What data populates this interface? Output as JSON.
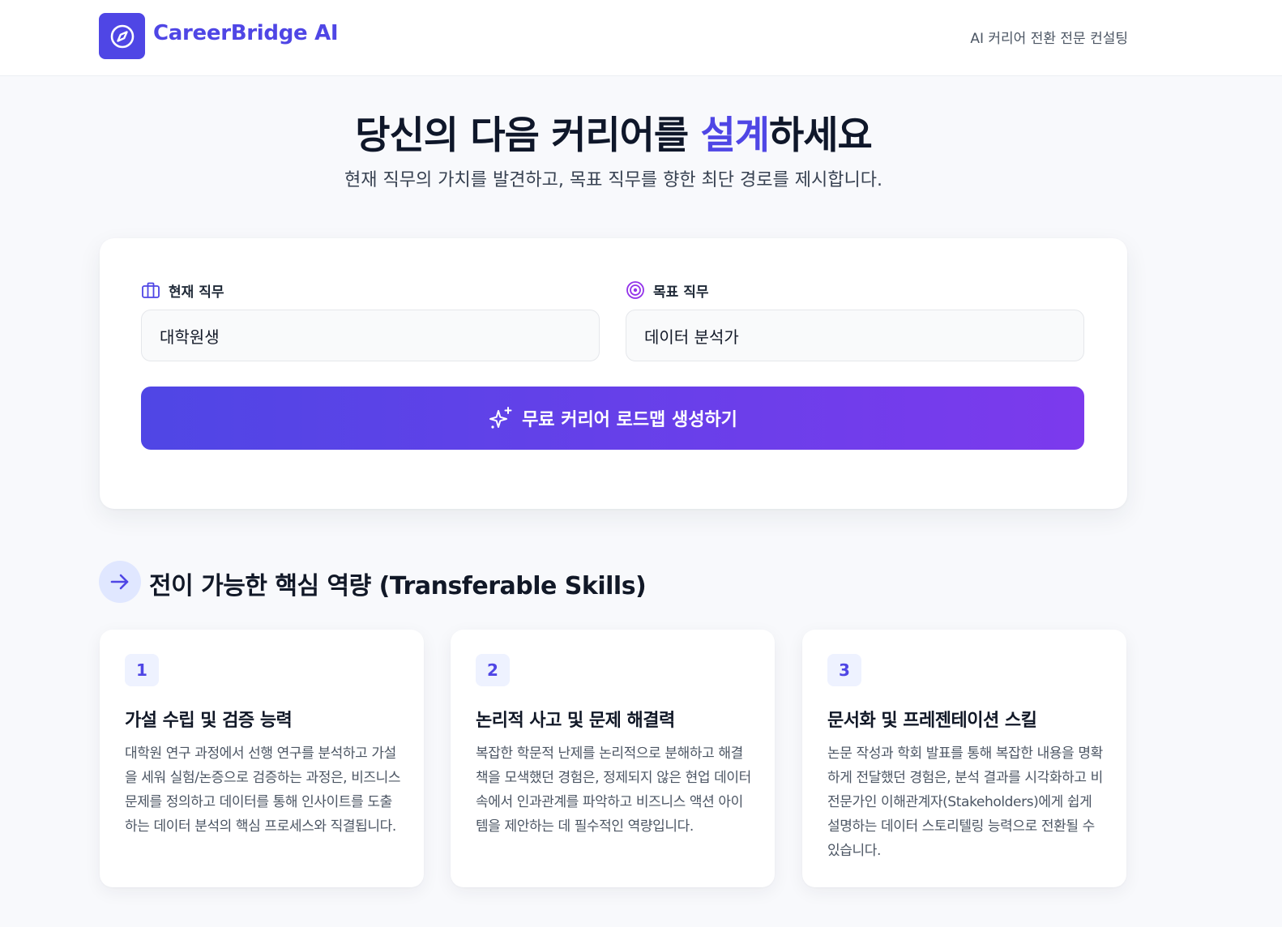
{
  "header": {
    "brand": "CareerBridge AI",
    "tagline": "AI 커리어 전환 전문 컨설팅",
    "logo_icon": "compass-icon"
  },
  "hero": {
    "title_before": "당신의 다음 커리어를 ",
    "title_accent": "설계",
    "title_after": "하세요",
    "subtitle": "현재 직무의 가치를 발견하고, 목표 직무를 향한 최단 경로를 제시합니다."
  },
  "form": {
    "current_label": "현재 직무",
    "current_value": "대학원생",
    "target_label": "목표 직무",
    "target_value": "데이터 분석가",
    "cta_label": "무료 커리어 로드맵 생성하기"
  },
  "skills_section": {
    "title": "전이 가능한 핵심 역량 (Transferable Skills)",
    "items": [
      {
        "number": "1",
        "title": "가설 수립 및 검증 능력",
        "description": "대학원 연구 과정에서 선행 연구를 분석하고 가설을 세워 실험/논증으로 검증하는 과정은, 비즈니스 문제를 정의하고 데이터를 통해 인사이트를 도출하는 데이터 분석의 핵심 프로세스와 직결됩니다."
      },
      {
        "number": "2",
        "title": "논리적 사고 및 문제 해결력",
        "description": "복잡한 학문적 난제를 논리적으로 분해하고 해결책을 모색했던 경험은, 정제되지 않은 현업 데이터 속에서 인과관계를 파악하고 비즈니스 액션 아이템을 제안하는 데 필수적인 역량입니다."
      },
      {
        "number": "3",
        "title": "문서화 및 프레젠테이션 스킬",
        "description": "논문 작성과 학회 발표를 통해 복잡한 내용을 명확하게 전달했던 경험은, 분석 결과를 시각화하고 비전문가인 이해관계자(Stakeholders)에게 쉽게 설명하는 데이터 스토리텔링 능력으로 전환될 수 있습니다."
      }
    ]
  },
  "colors": {
    "accent": "#4f46e5",
    "gradient_end": "#7c3aed"
  }
}
